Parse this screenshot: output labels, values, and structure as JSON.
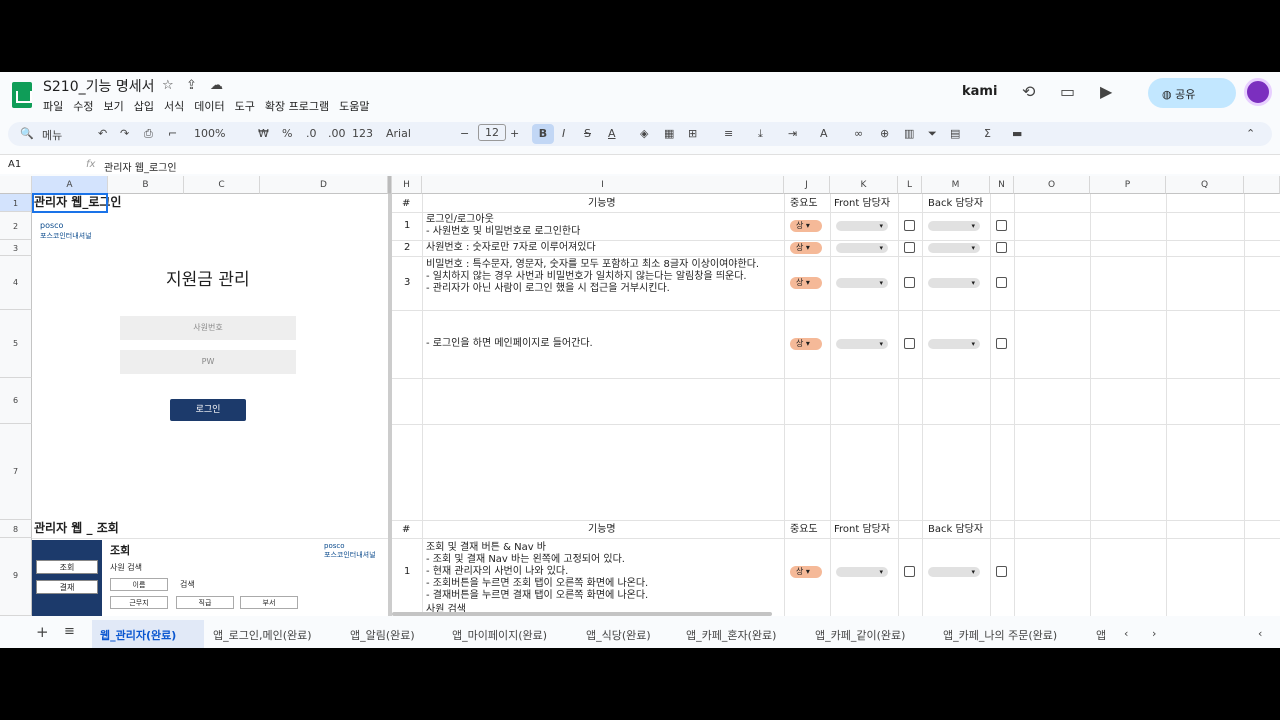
{
  "doc": {
    "title": "S210_기능 명세서",
    "menus": [
      "파일",
      "수정",
      "보기",
      "삽입",
      "서식",
      "데이터",
      "도구",
      "확장 프로그램",
      "도움말"
    ],
    "brand": "kami",
    "share_label": "공유"
  },
  "toolbar": {
    "search": "메뉴",
    "zoom": "100%",
    "currency": "₩",
    "percent": "%",
    "dec_less": ".0",
    "dec_more": ".00",
    "num_format": "123",
    "font": "Arial",
    "font_size": "12"
  },
  "formula": {
    "cell_ref": "A1",
    "fx": "fx",
    "value": "관리자 웹_로그인"
  },
  "columns": [
    "A",
    "B",
    "C",
    "D",
    "H",
    "I",
    "J",
    "K",
    "L",
    "M",
    "N",
    "O",
    "P",
    "Q"
  ],
  "rows": [
    "1",
    "2",
    "3",
    "4",
    "5",
    "6",
    "7",
    "8",
    "9"
  ],
  "sheet": {
    "sec1_title": "관리자 웹_로그인",
    "posco": "posco",
    "posco_sub": "포스코인터내셔널",
    "app_title": "지원금 관리",
    "emp_no": "사원번호",
    "pw": "PW",
    "login_btn": "로그인",
    "sec2_title": "관리자 웹 _ 조회",
    "nav_search": "조회",
    "nav_pay": "결재",
    "panel_title": "조회",
    "panel_sub": "사원 검색",
    "name_field": "이름",
    "search_btn": "검색",
    "work_dd": "근무지",
    "rank_dd": "직급",
    "dept_dd": "부서",
    "hdr_num": "#",
    "hdr_feature": "기능명",
    "hdr_priority": "중요도",
    "hdr_front": "Front 담당자",
    "hdr_back": "Back 담당자",
    "items": [
      {
        "num": "1",
        "text": "로그인/로그아웃\n- 사원번호 및 비밀번호로 로그인한다",
        "priority": "상"
      },
      {
        "num": "2",
        "text": "사원번호 : 숫자로만 7자로 이루어져있다",
        "priority": "상"
      },
      {
        "num": "3",
        "text": "비밀번호 : 특수문자, 영문자, 숫자를 모두 포함하고 최소 8글자 이상이여야한다.\n- 일치하지 않는 경우 사번과 비밀번호가 일치하지 않는다는 알림창을 띄운다.\n- 관리자가 아닌 사람이 로그인 했을 시 접근을 거부시킨다.",
        "priority": "상"
      },
      {
        "num": "",
        "text": "- 로그인을 하면 메인페이지로 들어간다.",
        "priority": "상"
      }
    ],
    "items2": [
      {
        "num": "1",
        "text": "조회 및 결재 버튼 & Nav 바\n- 조회 및 결재 Nav 바는 왼쪽에 고정되어 있다.\n- 현재 관리자의 사번이 나와 있다.\n- 조회버튼을 누르면 조회 탭이 오른쪽 화면에 나온다.\n- 결재버튼을 누르면 결재 탭이 오른쪽 화면에 나온다.",
        "priority": "상"
      },
      {
        "num": "",
        "text": "사원 검색",
        "priority": ""
      }
    ]
  },
  "tabs": [
    "웹_관리자(완료)",
    "앱_로그인,메인(완료)",
    "앱_알림(완료)",
    "앱_마이페이지(완료)",
    "앱_식당(완료)",
    "앱_카페_혼자(완료)",
    "앱_카페_같이(완료)",
    "앱_카페_나의 주문(완료)",
    "앱"
  ]
}
